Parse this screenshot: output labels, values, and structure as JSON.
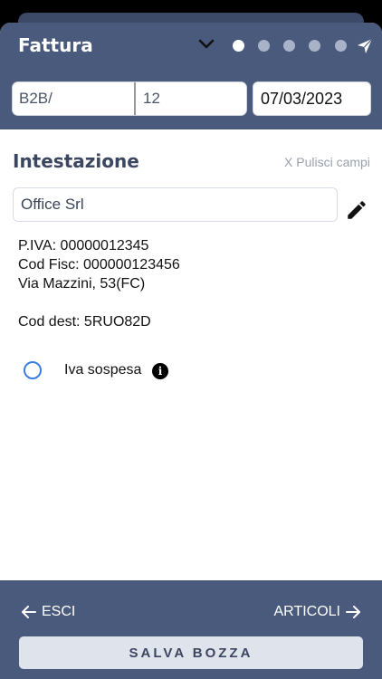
{
  "header": {
    "title": "Fattura",
    "step_count": 5,
    "active_step": 1
  },
  "document": {
    "prefix": "B2B/",
    "number": "12",
    "date": "07/03/2023"
  },
  "section": {
    "title": "Intestazione",
    "clear_label": "X Pulisci campi"
  },
  "customer": {
    "name": "Office Srl",
    "piva": "P.IVA: 00000012345",
    "cod_fisc": "Cod Fisc: 000000123456",
    "address": "Via Mazzini, 53(FC)",
    "cod_dest": "Cod dest: 5RUO82D"
  },
  "iva": {
    "label": "Iva sospesa",
    "checked": false
  },
  "footer": {
    "exit_label": "ESCI",
    "next_label": "ARTICOLI",
    "save_label": "SALVA BOZZA"
  },
  "colors": {
    "header_bg": "#4a5a7c",
    "radio_accent": "#3c7ee0",
    "text_dark": "#3b4661"
  }
}
